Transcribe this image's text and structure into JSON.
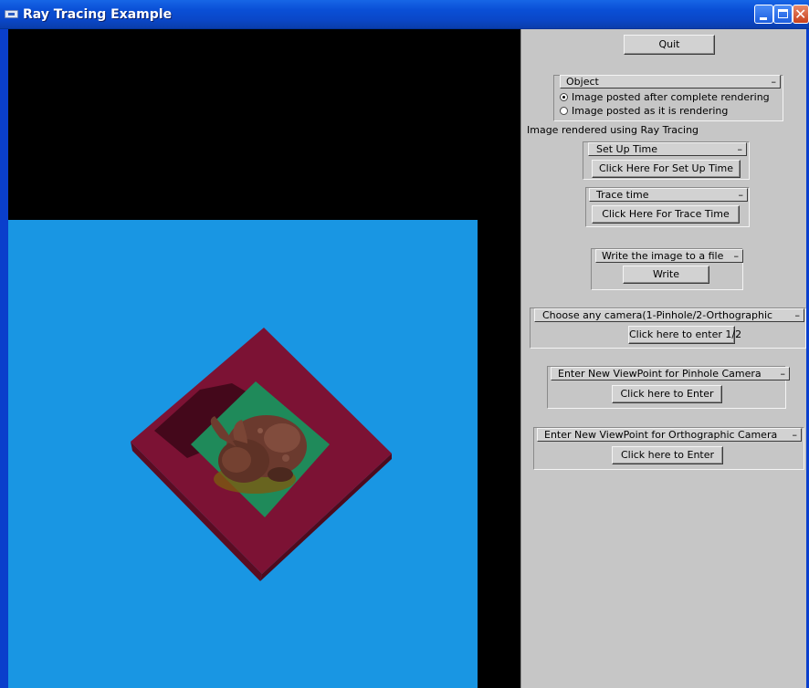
{
  "window": {
    "title": "Ray Tracing Example",
    "minimize_icon": "minimize-icon",
    "maximize_icon": "maximize-icon",
    "close_icon": "close-icon",
    "close_glyph": "✕"
  },
  "colors": {
    "background": "#1996e3",
    "floor_red": "#7c1234",
    "inner_green": "#1f8a5a",
    "bunny_brown": "#6b3a2e",
    "panel_gray": "#c6c6c6"
  },
  "panel": {
    "quit_label": "Quit",
    "object_group": {
      "title": "Object",
      "collapse": "–",
      "options": [
        {
          "label": "Image posted after complete rendering",
          "selected": true
        },
        {
          "label": "Image posted as it is rendering",
          "selected": false
        }
      ]
    },
    "status_text": "Image rendered using Ray Tracing",
    "setup_group": {
      "title": "Set Up Time",
      "collapse": "–",
      "button": "Click Here For Set Up Time"
    },
    "trace_group": {
      "title": "Trace time",
      "collapse": "–",
      "button": "Click Here For Trace Time"
    },
    "write_group": {
      "title": "Write the image to a file",
      "collapse": "–",
      "button": "Write"
    },
    "camera_group": {
      "title": "Choose any camera(1-Pinhole/2-Orthographic",
      "collapse": "–",
      "button": "Click here to enter 1/2"
    },
    "pinhole_group": {
      "title": "Enter New ViewPoint for Pinhole Camera",
      "collapse": "–",
      "button": "Click here to Enter"
    },
    "ortho_group": {
      "title": "Enter New ViewPoint for Orthographic Camera",
      "collapse": "–",
      "button": "Click here to Enter"
    }
  }
}
